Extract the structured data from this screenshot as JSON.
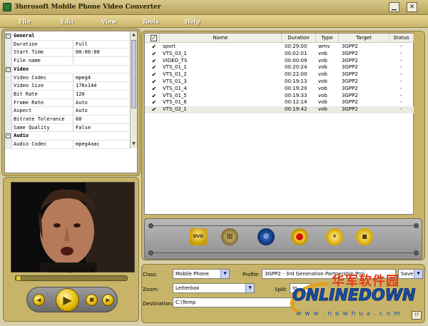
{
  "window": {
    "title": "3herosoft Mobile Phone Video Converter",
    "minimize_glyph": "▁",
    "close_glyph": "✕"
  },
  "menu": [
    "File",
    "Edit",
    "View",
    "Tools",
    "Help"
  ],
  "properties": {
    "general": {
      "label": "General",
      "rows": [
        {
          "key": "Duration",
          "value": "Full"
        },
        {
          "key": "Start Time",
          "value": "00:00:00"
        },
        {
          "key": "File name",
          "value": ""
        }
      ]
    },
    "video": {
      "label": "Video",
      "rows": [
        {
          "key": "Video Codec",
          "value": "mpeg4"
        },
        {
          "key": "Video Size",
          "value": "176x144"
        },
        {
          "key": "Bit Rate",
          "value": "120"
        },
        {
          "key": "Frame Rate",
          "value": "Auto"
        },
        {
          "key": "Aspect",
          "value": "Auto"
        },
        {
          "key": "Bitrate Tolerance",
          "value": "60"
        },
        {
          "key": "Same Quality",
          "value": "False"
        }
      ]
    },
    "audio": {
      "label": "Audio",
      "rows": [
        {
          "key": "Audio Codec",
          "value": "mpeg4aac"
        }
      ]
    }
  },
  "player": {
    "time_readout": "00:00:01/00:19:42",
    "progress_fraction": 0.003,
    "buttons": {
      "prev": "◀",
      "play": "▶",
      "stop": "■",
      "next": "▶"
    }
  },
  "file_list": {
    "columns": [
      "Name",
      "Duration",
      "Type",
      "Target",
      "Status"
    ],
    "rows": [
      {
        "checked": "✔",
        "name": "sport",
        "duration": "00:29:00",
        "type": "wmv",
        "target": "3GPP2",
        "status": "-"
      },
      {
        "checked": "✔",
        "name": "VTS_03_1",
        "duration": "00:02:01",
        "type": "vob",
        "target": "3GPP2",
        "status": "-"
      },
      {
        "checked": "✔",
        "name": "VIDEO_TS",
        "duration": "00:00:09",
        "type": "vob",
        "target": "3GPP2",
        "status": "-"
      },
      {
        "checked": "✔",
        "name": "VTS_01_1",
        "duration": "00:20:24",
        "type": "vob",
        "target": "3GPP2",
        "status": "-"
      },
      {
        "checked": "✔",
        "name": "VTS_01_2",
        "duration": "00:22:00",
        "type": "vob",
        "target": "3GPP2",
        "status": "-"
      },
      {
        "checked": "✔",
        "name": "VTS_01_3",
        "duration": "00:19:13",
        "type": "vob",
        "target": "3GPP2",
        "status": "-"
      },
      {
        "checked": "✔",
        "name": "VTS_01_4",
        "duration": "00:19:20",
        "type": "vob",
        "target": "3GPP2",
        "status": "-"
      },
      {
        "checked": "✔",
        "name": "VTS_01_5",
        "duration": "00:19:33",
        "type": "vob",
        "target": "3GPP2",
        "status": "-"
      },
      {
        "checked": "✔",
        "name": "VTS_01_6",
        "duration": "00:12:14",
        "type": "vob",
        "target": "3GPP2",
        "status": "-"
      },
      {
        "checked": "✔",
        "name": "VTS_02_1",
        "duration": "00:19:42",
        "type": "vob",
        "target": "3GPP2",
        "status": "-"
      }
    ]
  },
  "toolbar": {
    "dvd_label": "DVD"
  },
  "settings": {
    "class_label": "Class:",
    "class_value": "Mobile Phone",
    "profile_label": "Profile:",
    "profile_value": "3GPP2 - 3rd Generation Partnership Proj",
    "extra_value": "Save As",
    "zoom_label": "Zoom:",
    "zoom_value": "Letterbox",
    "split_label": "Split:",
    "split_value": "In",
    "destination_label": "Destination:",
    "destination_value": "C:\\Temp",
    "help_label": "!?"
  },
  "watermark": {
    "chinese": "华军软件园",
    "logo": "ONLINEDOWN",
    "url": "w w w . n e w h u a . c o m"
  },
  "colors": {
    "frame_gold": "#c8b468",
    "menu_text": "#ffffff",
    "selected_row": "#ecebe2",
    "watermark_red": "#e23a16",
    "watermark_blue": "#1a4fa8"
  }
}
